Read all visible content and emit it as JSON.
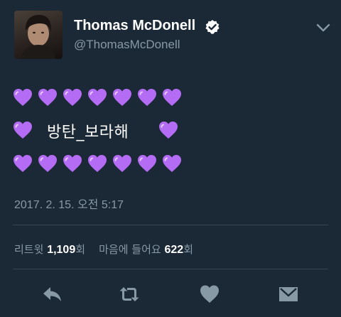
{
  "tweet": {
    "author_name": "Thomas McDonell",
    "author_handle": "@ThomasMcDonell",
    "verified": true,
    "text": "방탄_보라해",
    "heart_rows": [
      7,
      2,
      7
    ],
    "timestamp": "2017. 2. 15. 오전 5:17"
  },
  "stats": {
    "retweets_label": "리트윗",
    "retweets_count": "1,109",
    "retweets_unit": "회",
    "likes_label": "마음에 들어요",
    "likes_count": "622",
    "likes_unit": "회"
  },
  "actions": [
    "reply-icon",
    "retweet-icon",
    "like-icon",
    "direct-message-icon"
  ],
  "colors": {
    "background": "#1b2836",
    "secondary_text": "#8899a6",
    "divider": "#38444d",
    "heart_purple": "#b56cf5",
    "action_icon": "#8899a6"
  }
}
